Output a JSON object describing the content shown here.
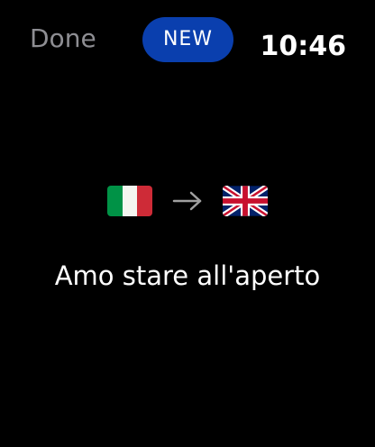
{
  "header": {
    "done_label": "Done",
    "new_label": "NEW",
    "time": "10:46"
  },
  "translation": {
    "source_flag": "italy-flag-icon",
    "target_flag": "uk-flag-icon",
    "phrase": "Amo stare all'aperto"
  },
  "colors": {
    "background": "#000000",
    "new_button": "#0a3fae",
    "done_text": "#8e8e93",
    "text": "#ffffff"
  }
}
